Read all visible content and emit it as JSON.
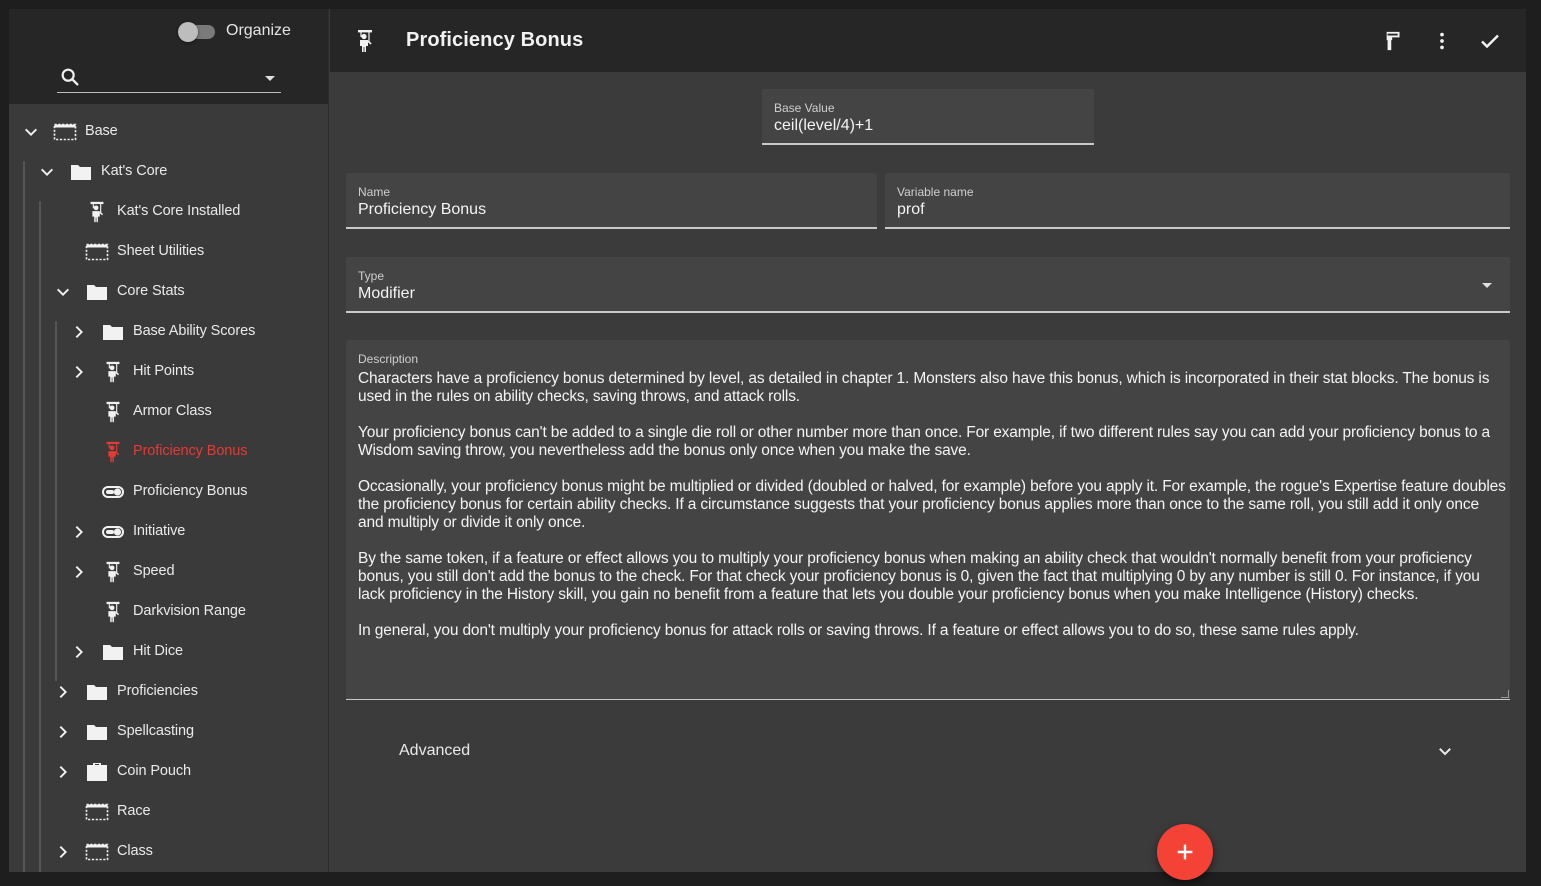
{
  "sidebar": {
    "organize_label": "Organize",
    "organize_enabled": false,
    "search_placeholder": "",
    "items": [
      {
        "label": "Base",
        "icon": "dashed-box-icon",
        "expand": "expanded",
        "depth": 0
      },
      {
        "label": "Kat's Core",
        "icon": "folder-icon",
        "expand": "expanded",
        "depth": 1
      },
      {
        "label": "Kat's Core Installed",
        "icon": "puppet-icon",
        "expand": "none",
        "depth": 2
      },
      {
        "label": "Sheet Utilities",
        "icon": "dashed-box-icon",
        "expand": "none",
        "depth": 2
      },
      {
        "label": "Core Stats",
        "icon": "folder-icon",
        "expand": "expanded",
        "depth": 2
      },
      {
        "label": "Base Ability Scores",
        "icon": "folder-icon",
        "expand": "collapsed",
        "depth": 3
      },
      {
        "label": "Hit Points",
        "icon": "puppet-icon",
        "expand": "collapsed",
        "depth": 3
      },
      {
        "label": "Armor Class",
        "icon": "puppet-icon",
        "expand": "none",
        "depth": 3
      },
      {
        "label": "Proficiency Bonus",
        "icon": "puppet-icon",
        "expand": "none",
        "depth": 3,
        "active": true
      },
      {
        "label": "Proficiency Bonus",
        "icon": "toggle-icon",
        "expand": "none",
        "depth": 3
      },
      {
        "label": "Initiative",
        "icon": "toggle-icon",
        "expand": "collapsed",
        "depth": 3
      },
      {
        "label": "Speed",
        "icon": "puppet-icon",
        "expand": "collapsed",
        "depth": 3
      },
      {
        "label": "Darkvision Range",
        "icon": "puppet-icon",
        "expand": "none",
        "depth": 3
      },
      {
        "label": "Hit Dice",
        "icon": "folder-icon",
        "expand": "collapsed",
        "depth": 3
      },
      {
        "label": "Proficiencies",
        "icon": "folder-icon",
        "expand": "collapsed",
        "depth": 2
      },
      {
        "label": "Spellcasting",
        "icon": "folder-icon",
        "expand": "collapsed",
        "depth": 2
      },
      {
        "label": "Coin Pouch",
        "icon": "briefcase-icon",
        "expand": "collapsed",
        "depth": 2
      },
      {
        "label": "Race",
        "icon": "dashed-box-icon",
        "expand": "none",
        "depth": 2
      },
      {
        "label": "Class",
        "icon": "dashed-box-icon",
        "expand": "collapsed",
        "depth": 2
      }
    ]
  },
  "header": {
    "icon": "puppet-icon",
    "title": "Proficiency Bonus",
    "actions": [
      {
        "name": "paint-roller-icon",
        "label": "format"
      },
      {
        "name": "more-vert-icon",
        "label": "more"
      },
      {
        "name": "check-icon",
        "label": "done"
      }
    ]
  },
  "form": {
    "base_value": {
      "label": "Base Value",
      "value": "ceil(level/4)+1"
    },
    "name": {
      "label": "Name",
      "value": "Proficiency Bonus"
    },
    "variable_name": {
      "label": "Variable name",
      "value": "prof"
    },
    "type": {
      "label": "Type",
      "value": "Modifier"
    },
    "description": {
      "label": "Description",
      "paragraphs": [
        "Characters have a proficiency bonus determined by level, as detailed in chapter 1. Monsters also have this bonus, which is incorporated in their stat blocks. The bonus is used in the rules on ability checks, saving throws, and attack rolls.",
        "Your proficiency bonus can't be added to a single die roll or other number more than once. For example, if two different rules say you can add your proficiency bonus to a Wisdom saving throw, you nevertheless add the bonus only once when you make the save.",
        "Occasionally, your proficiency bonus might be multiplied or divided (doubled or halved, for example) before you apply it. For example, the rogue's Expertise feature doubles the proficiency bonus for certain ability checks. If a circumstance suggests that your proficiency bonus applies more than once to the same roll, you still add it only once and multiply or divide it only once.",
        "By the same token, if a feature or effect allows you to multiply your proficiency bonus when making an ability check that wouldn't normally benefit from your proficiency bonus, you still don't add the bonus to the check. For that check your proficiency bonus is 0, given the fact that multiplying 0 by any number is still 0. For instance, if you lack proficiency in the History skill, you gain no benefit from a feature that lets you double your proficiency bonus when you make Intelligence (History) checks.",
        "In general, you don't multiply your proficiency bonus for attack rolls or saving throws. If a feature or effect allows you to do so, these same rules apply."
      ]
    },
    "advanced_label": "Advanced"
  },
  "fab": {
    "icon": "plus-icon"
  },
  "colors": {
    "accent": "#f44336",
    "active_item": "#e53935",
    "panel_dark": "#262626",
    "panel": "#3b3b3b",
    "field": "#444444"
  }
}
